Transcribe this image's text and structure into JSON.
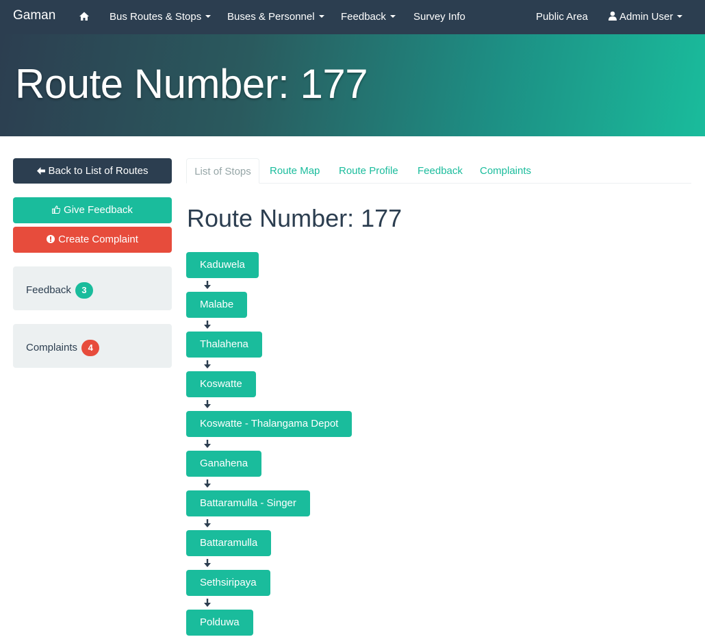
{
  "navbar": {
    "brand": "Gaman",
    "items": [
      {
        "label": "Bus Routes & Stops",
        "dropdown": true
      },
      {
        "label": "Buses & Personnel",
        "dropdown": true
      },
      {
        "label": "Feedback",
        "dropdown": true
      },
      {
        "label": "Survey Info",
        "dropdown": false
      }
    ],
    "public_area": "Public Area",
    "user": "Admin User"
  },
  "banner": {
    "title": "Route Number: 177"
  },
  "sidebar": {
    "back_label": "Back to List of Routes",
    "give_feedback_label": "Give Feedback",
    "create_complaint_label": "Create Complaint",
    "feedback_label": "Feedback",
    "feedback_count": "3",
    "complaints_label": "Complaints",
    "complaints_count": "4"
  },
  "tabs": [
    "List of Stops",
    "Route Map",
    "Route Profile",
    "Feedback",
    "Complaints"
  ],
  "active_tab": "List of Stops",
  "content": {
    "title": "Route Number: 177",
    "stops": [
      "Kaduwela",
      "Malabe",
      "Thalahena",
      "Koswatte",
      "Koswatte - Thalangama Depot",
      "Ganahena",
      "Battaramulla - Singer",
      "Battaramulla",
      "Sethsiripaya",
      "Polduwa"
    ]
  },
  "colors": {
    "navbar": "#2c3e50",
    "primary": "#1abc9c",
    "danger": "#e74c3c",
    "well": "#ecf0f1"
  }
}
